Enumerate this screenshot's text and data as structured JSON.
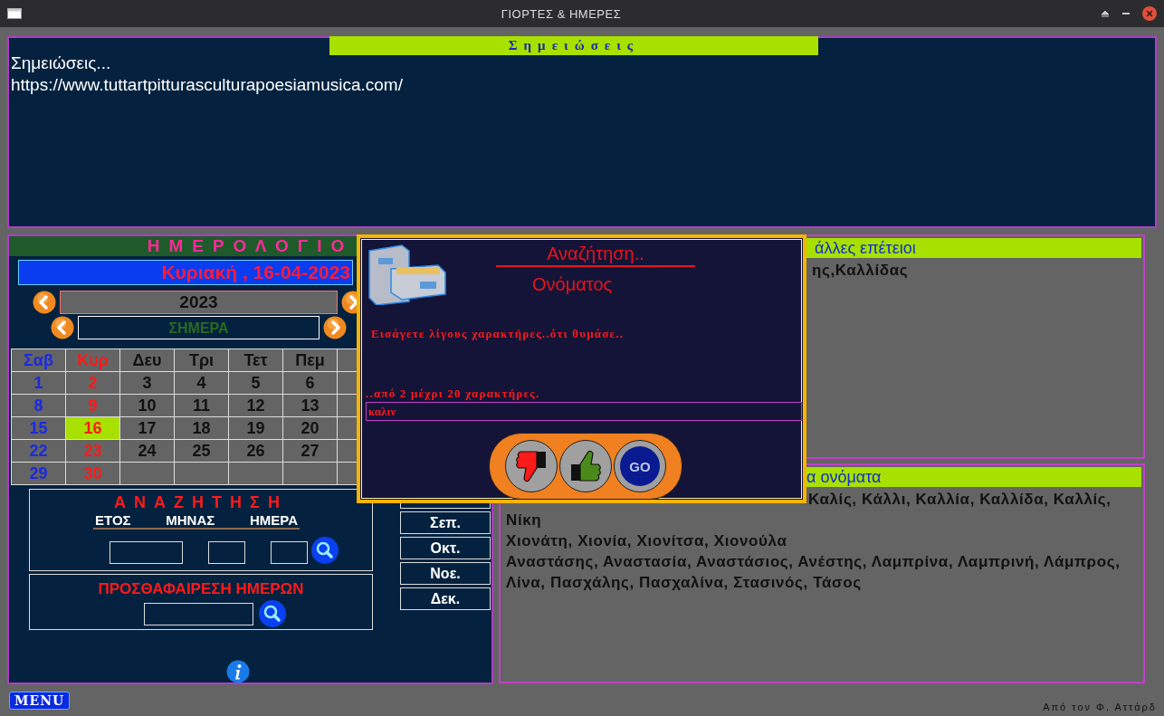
{
  "window": {
    "title": "ΓΙΟΡΤΕΣ & ΗΜΕΡΕΣ"
  },
  "notes": {
    "title": "Σημειώσεις",
    "lines": [
      "Σημειώσεις...",
      "https://www.tuttartpitturasculturapoesiamusica.com/"
    ]
  },
  "calendar": {
    "title": "ΗΜΕΡΟΛΟΓΙΟ",
    "date": "Κυριακή , 16-04-2023",
    "year": "2023",
    "today": "ΣΗΜΕΡΑ",
    "weekdays": [
      {
        "label": "Σαβ",
        "kind": "saturday"
      },
      {
        "label": "Κυρ",
        "kind": "sunday"
      },
      {
        "label": "Δευ",
        "kind": "weekday"
      },
      {
        "label": "Τρι",
        "kind": "weekday"
      },
      {
        "label": "Τετ",
        "kind": "weekday"
      },
      {
        "label": "Πεμ",
        "kind": "weekday"
      }
    ],
    "weeks": [
      [
        {
          "day": "1",
          "kind": "saturday",
          "selected": false
        },
        {
          "day": "2",
          "kind": "sunday",
          "selected": false
        },
        {
          "day": "3",
          "kind": "weekday",
          "selected": false
        },
        {
          "day": "4",
          "kind": "weekday",
          "selected": false
        },
        {
          "day": "5",
          "kind": "weekday",
          "selected": false
        },
        {
          "day": "6",
          "kind": "weekday",
          "selected": false
        }
      ],
      [
        {
          "day": "8",
          "kind": "saturday",
          "selected": false
        },
        {
          "day": "9",
          "kind": "sunday",
          "selected": false
        },
        {
          "day": "10",
          "kind": "weekday",
          "selected": false
        },
        {
          "day": "11",
          "kind": "weekday",
          "selected": false
        },
        {
          "day": "12",
          "kind": "weekday",
          "selected": false
        },
        {
          "day": "13",
          "kind": "weekday",
          "selected": false
        }
      ],
      [
        {
          "day": "15",
          "kind": "saturday",
          "selected": false
        },
        {
          "day": "16",
          "kind": "sunday",
          "selected": true
        },
        {
          "day": "17",
          "kind": "weekday",
          "selected": false
        },
        {
          "day": "18",
          "kind": "weekday",
          "selected": false
        },
        {
          "day": "19",
          "kind": "weekday",
          "selected": false
        },
        {
          "day": "20",
          "kind": "weekday",
          "selected": false
        }
      ],
      [
        {
          "day": "22",
          "kind": "saturday",
          "selected": false
        },
        {
          "day": "23",
          "kind": "sunday",
          "selected": false
        },
        {
          "day": "24",
          "kind": "weekday",
          "selected": false
        },
        {
          "day": "25",
          "kind": "weekday",
          "selected": false
        },
        {
          "day": "26",
          "kind": "weekday",
          "selected": false
        },
        {
          "day": "27",
          "kind": "weekday",
          "selected": false
        }
      ],
      [
        {
          "day": "29",
          "kind": "saturday",
          "selected": false
        },
        {
          "day": "30",
          "kind": "sunday",
          "selected": false
        }
      ]
    ]
  },
  "search": {
    "title": "ΑΝΑΖΗΤΗΣΗ",
    "fields": [
      "ΕΤΟΣ",
      "ΜΗΝΑΣ",
      "ΗΜΕΡΑ"
    ]
  },
  "add_days": {
    "title": "ΠΡΟΣΘΑΦΑΙΡΕΣΗ ΗΜΕΡΩΝ"
  },
  "months": [
    "Σεπ.",
    "Οκτ.",
    "Νοε.",
    "Δεκ."
  ],
  "anniversaries": {
    "title": "άλλες επέτειοι",
    "text": "ης,Καλλίδας"
  },
  "names": {
    "title": "α ονόματα",
    "first_line": "Καλίς, Κάλλι, Καλλία, Καλλίδα, Καλλίς,",
    "lines": [
      "Νίκη",
      "Χιονάτη, Χιονία, Χιονίτσα, Χιονούλα",
      "Αναστάσης, Αναστασία, Αναστάσιος, Ανέστης, Λαμπρίνα, Λαμπρινή, Λάμπρος, Λίνα, Πασχάλης, Πασχαλίνα, Στασινός, Τάσος"
    ]
  },
  "dialog": {
    "title": "Αναζήτηση..",
    "subtitle": "Ονόματος",
    "prompt": "Εισάγετε λίγους χαρακτήρες..ότι θυμάσε..",
    "hint": "..από 2 μέχρι 20 χαρακτήρες.",
    "value": "καλιν",
    "go": "GO"
  },
  "footer": {
    "menu": "MENU",
    "credit": "Από τον Φ. Αττάρδ"
  }
}
